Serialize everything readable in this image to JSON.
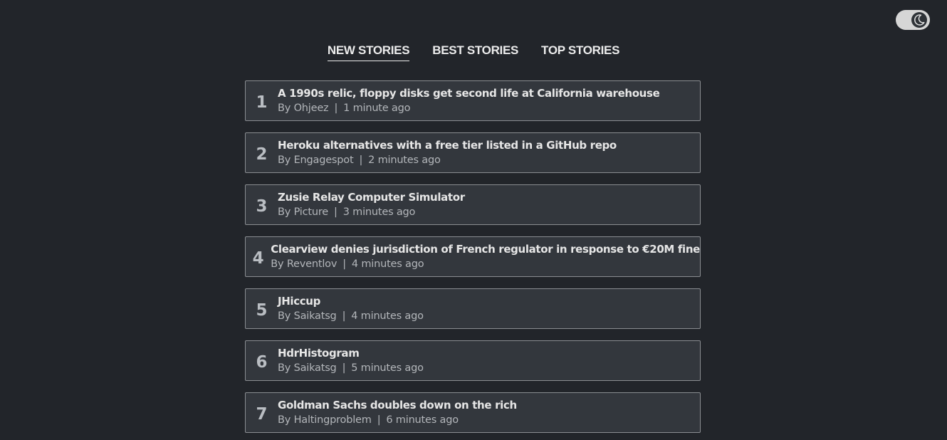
{
  "theme_toggle": {
    "icon": "moon-icon"
  },
  "tabs": [
    {
      "label": "NEW STORIES",
      "active": true
    },
    {
      "label": "BEST STORIES",
      "active": false
    },
    {
      "label": "TOP STORIES",
      "active": false
    }
  ],
  "stories": [
    {
      "rank": "1",
      "title": "A 1990s relic, floppy disks get second life at California warehouse",
      "by_prefix": "By",
      "author": "Ohjeez",
      "separator": "|",
      "time": "1 minute ago"
    },
    {
      "rank": "2",
      "title": "Heroku alternatives with a free tier listed in a GitHub repo",
      "by_prefix": "By",
      "author": "Engagespot",
      "separator": "|",
      "time": "2 minutes ago"
    },
    {
      "rank": "3",
      "title": "Zusie Relay Computer Simulator",
      "by_prefix": "By",
      "author": "Picture",
      "separator": "|",
      "time": "3 minutes ago"
    },
    {
      "rank": "4",
      "title": "Clearview denies jurisdiction of French regulator in response to €20M fine",
      "by_prefix": "By",
      "author": "Reventlov",
      "separator": "|",
      "time": "4 minutes ago"
    },
    {
      "rank": "5",
      "title": "JHiccup",
      "by_prefix": "By",
      "author": "Saikatsg",
      "separator": "|",
      "time": "4 minutes ago"
    },
    {
      "rank": "6",
      "title": "HdrHistogram",
      "by_prefix": "By",
      "author": "Saikatsg",
      "separator": "|",
      "time": "5 minutes ago"
    },
    {
      "rank": "7",
      "title": "Goldman Sachs doubles down on the rich",
      "by_prefix": "By",
      "author": "Haltingproblem",
      "separator": "|",
      "time": "6 minutes ago"
    }
  ]
}
